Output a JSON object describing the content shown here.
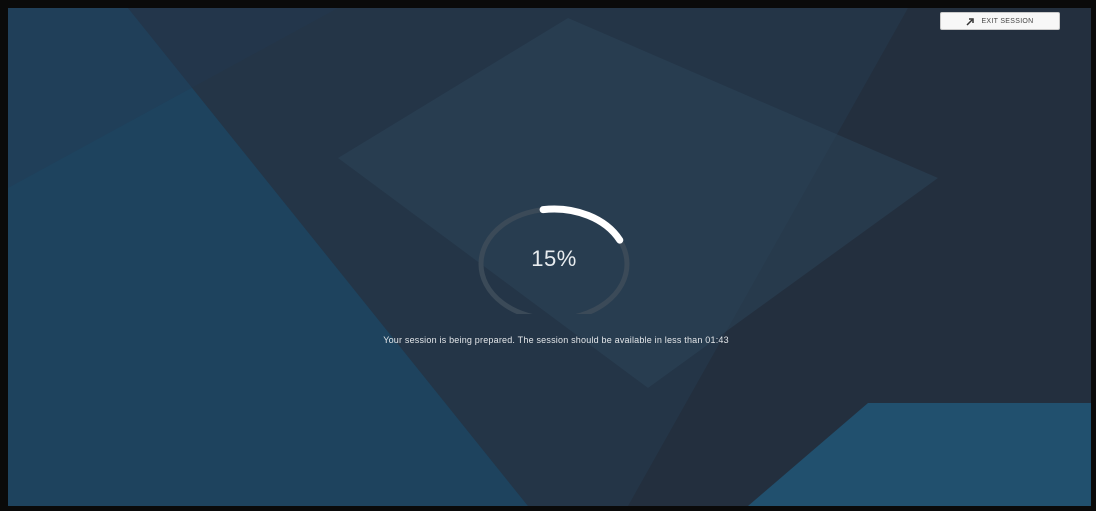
{
  "header": {
    "exit_button_label": "EXIT SESSION",
    "exit_icon": "exit-icon"
  },
  "progress": {
    "percent_label": "15%",
    "value": 0.15
  },
  "status": {
    "message": "Your session is being prepared. The session should be available in less than 01:43"
  },
  "colors": {
    "background": "#232f3e",
    "panel_light": "#1f4a66",
    "panel_mid": "#2b3f52",
    "ring_track": "#3b4a58",
    "ring_fill": "#ffffff",
    "text": "#e8ecef"
  }
}
